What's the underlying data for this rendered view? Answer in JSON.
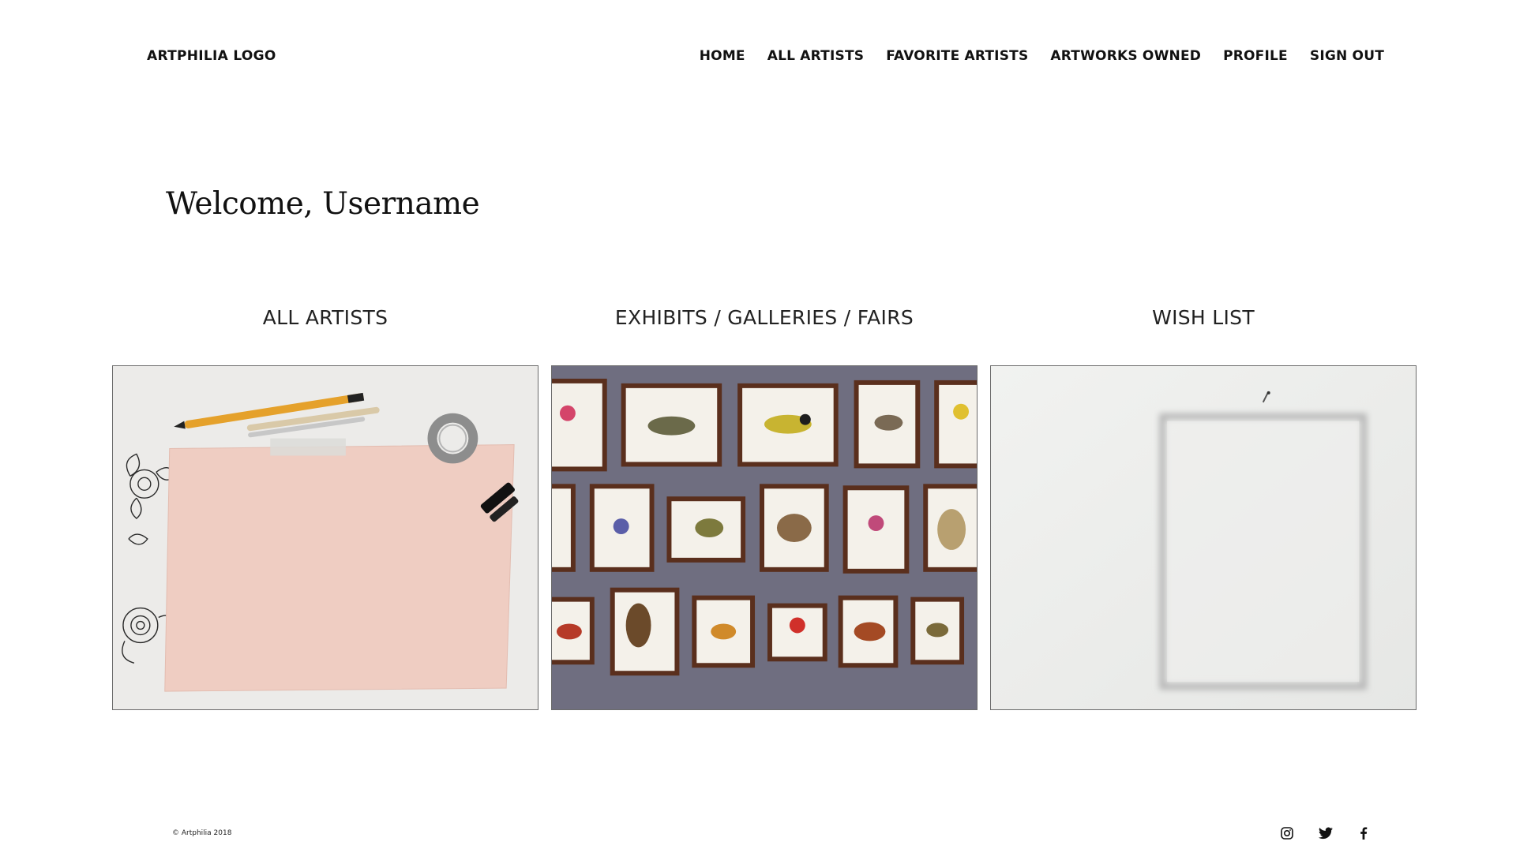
{
  "header": {
    "logo": "ARTPHILIA LOGO",
    "nav": [
      "HOME",
      "ALL ARTISTS",
      "FAVORITE ARTISTS",
      "ARTWORKS OWNED",
      "PROFILE",
      "SIGN OUT"
    ]
  },
  "welcome": "Welcome, Username",
  "cards": [
    {
      "title": "ALL ARTISTS"
    },
    {
      "title": "EXHIBITS / GALLERIES / FAIRS"
    },
    {
      "title": "WISH LIST"
    }
  ],
  "footer": {
    "copyright": "© Artphilia 2018",
    "social": [
      "instagram-icon",
      "twitter-icon",
      "facebook-icon"
    ]
  },
  "colors": {
    "text": "#111111",
    "card_border": "#6b6b6b",
    "gallery_wall": "#6f6e80",
    "paper_pink": "#efcdc2"
  }
}
